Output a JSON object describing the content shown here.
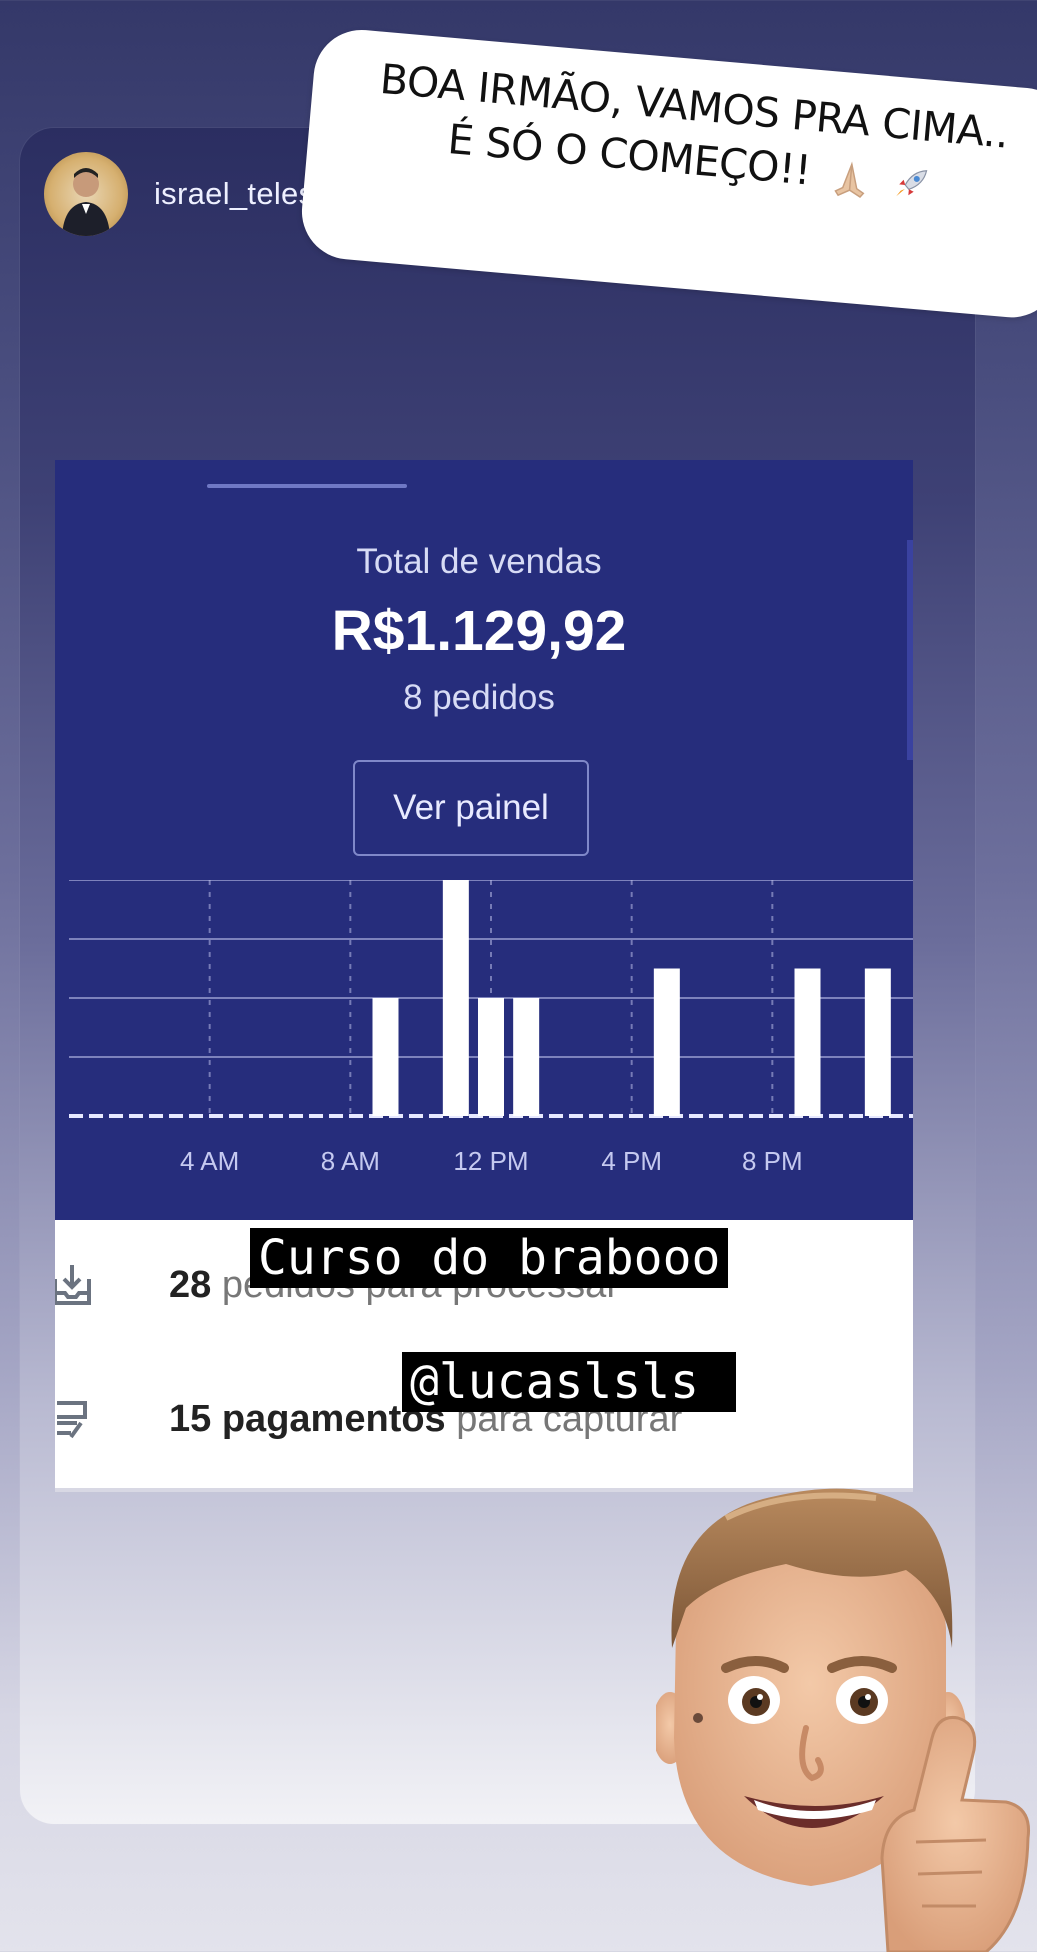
{
  "story": {
    "username": "israel_telessilva",
    "sticker_text_line1": "BOA IRMÃO, VAMOS PRA CIMA..",
    "sticker_text_line2": "É SÓ O COMEÇO!!",
    "sticker_emojis": [
      "folded-hands",
      "rocket"
    ]
  },
  "dashboard": {
    "total_label": "Total de vendas",
    "total_amount": "R$1.129,92",
    "orders_count": "8 pedidos",
    "view_button": "Ver painel"
  },
  "chart_data": {
    "type": "bar",
    "x_tick_labels": [
      "4 AM",
      "8 AM",
      "12 PM",
      "4 PM",
      "8 PM"
    ],
    "bars": [
      {
        "hour": 9,
        "value": 2
      },
      {
        "hour": 11,
        "value": 4
      },
      {
        "hour": 12,
        "value": 2
      },
      {
        "hour": 13,
        "value": 2
      },
      {
        "hour": 17,
        "value": 2.5
      },
      {
        "hour": 21,
        "value": 2.5
      },
      {
        "hour": 23,
        "value": 2.5
      }
    ],
    "xlim": [
      0,
      24
    ],
    "ylim": [
      0,
      4
    ],
    "grid": true,
    "colors": {
      "bar": "#ffffff",
      "background": "#262d7c",
      "grid": "#c5c9f0"
    }
  },
  "tasks": {
    "orders_count": "28",
    "orders_text_obscured": "pedidos para processar",
    "payments_count": "15",
    "payments_text_a": "pagamentos",
    "payments_text_b": "para capturar"
  },
  "captions": {
    "course": "Curso do brabooo",
    "handle": "@lucaslsls "
  }
}
